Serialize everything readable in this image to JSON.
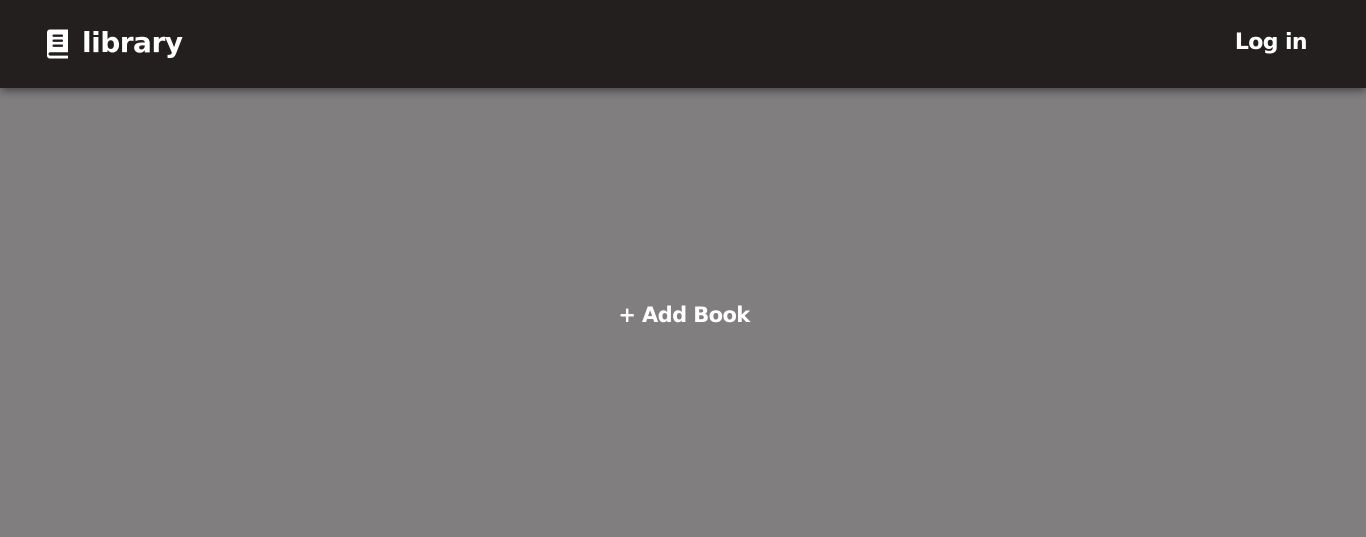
{
  "header": {
    "logo_icon": "book-icon",
    "app_name": "library",
    "login_label": "Log in",
    "background_color": "#231f1f",
    "text_color": "#ffffff"
  },
  "main": {
    "add_book_label": "+ Add Book",
    "background_color": "#807e7f"
  }
}
